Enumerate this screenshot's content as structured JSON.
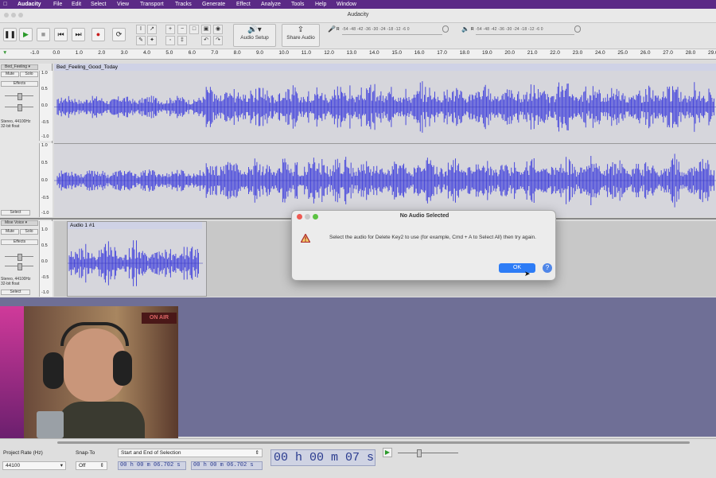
{
  "menubar": {
    "items": [
      "Audacity",
      "File",
      "Edit",
      "Select",
      "View",
      "Transport",
      "Tracks",
      "Generate",
      "Effect",
      "Analyze",
      "Tools",
      "Help",
      "Window"
    ]
  },
  "window": {
    "title": "Audacity"
  },
  "toolbar": {
    "audio_setup_label": "Audio Setup",
    "share_audio_label": "Share Audio",
    "meter_scale": "-54 -48 -42 -36 -30 -24 -18 -12 -6 0",
    "meter_record_letter": "R",
    "meter_play_letter": "R"
  },
  "ruler": {
    "ticks": [
      "-1.0",
      "0.0",
      "1.0",
      "2.0",
      "3.0",
      "4.0",
      "5.0",
      "6.0",
      "7.0",
      "8.0",
      "9.0",
      "10.0",
      "11.0",
      "12.0",
      "13.0",
      "14.0",
      "15.0",
      "16.0",
      "17.0",
      "18.0",
      "19.0",
      "20.0",
      "21.0",
      "22.0",
      "23.0",
      "24.0",
      "25.0",
      "26.0",
      "27.0",
      "28.0",
      "29.0"
    ]
  },
  "tracks": [
    {
      "name": "Bed_Feeling",
      "clip_title": "Bed_Feeling_Good_Today",
      "mute": "Mute",
      "solo": "Solo",
      "effects": "Effects",
      "info1": "Stereo, 44100Hz",
      "info2": "32-bit float",
      "select": "Select",
      "scale": [
        "1.0",
        "0.5",
        "0.0",
        "-0.5",
        "-1.0"
      ]
    },
    {
      "name": "Mise Voice",
      "clip_title": "Audio 1 #1",
      "mute": "Mute",
      "solo": "Solo",
      "effects": "Effects",
      "info1": "Stereo, 44100Hz",
      "info2": "32-bit float",
      "select": "Select",
      "scale": [
        "1.0",
        "0.5",
        "0.0",
        "-0.5",
        "-1.0"
      ]
    }
  ],
  "webcam": {
    "sign": "ON AIR"
  },
  "dialog": {
    "title": "No Audio Selected",
    "message": "Select the audio for Delete Key2 to use (for example, Cmd + A to Select All) then try again.",
    "ok_label": "OK",
    "help_label": "?"
  },
  "bottombar": {
    "project_rate_label": "Project Rate (Hz)",
    "project_rate_value": "44100",
    "snap_to_label": "Snap-To",
    "snap_to_value": "Off",
    "selection_mode": "Start and End of Selection",
    "selection_start": "00 h 00 m 06.702 s",
    "selection_end": "00 h 00 m 06.702 s",
    "audio_position": "00 h 00 m 07 s"
  },
  "colors": {
    "waveform": "#4a4adc",
    "menubar": "#5b2a86",
    "ok_button": "#2d7cf6"
  }
}
